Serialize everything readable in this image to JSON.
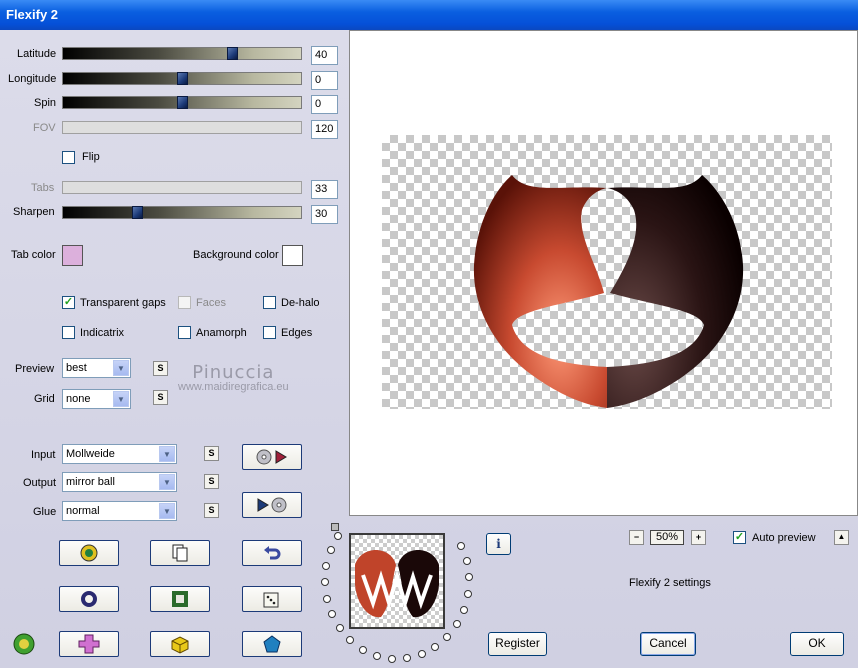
{
  "window": {
    "title": "Flexify 2"
  },
  "sliders": [
    {
      "label": "Latitude",
      "value": "40",
      "position": 0.71,
      "disabled": false
    },
    {
      "label": "Longitude",
      "value": "0",
      "position": 0.5,
      "disabled": false
    },
    {
      "label": "Spin",
      "value": "0",
      "position": 0.5,
      "disabled": false
    },
    {
      "label": "FOV",
      "value": "120",
      "disabled": true
    },
    {
      "label": "Tabs",
      "value": "33",
      "disabled": true
    },
    {
      "label": "Sharpen",
      "value": "30",
      "position": 0.31,
      "disabled": false
    }
  ],
  "flip": {
    "label": "Flip",
    "checked": false
  },
  "colors": {
    "tab_label": "Tab color",
    "tab_color": "#dcb0dc",
    "background_label": "Background color",
    "background_color": "#ffffff"
  },
  "options": {
    "transparent_gaps": {
      "label": "Transparent gaps",
      "checked": true
    },
    "faces": {
      "label": "Faces",
      "checked": false,
      "disabled": true
    },
    "de_halo": {
      "label": "De-halo",
      "checked": false
    },
    "indicatrix": {
      "label": "Indicatrix",
      "checked": false
    },
    "anamorph": {
      "label": "Anamorph",
      "checked": false
    },
    "edges": {
      "label": "Edges",
      "checked": false
    }
  },
  "selects": {
    "preview": {
      "label": "Preview",
      "value": "best"
    },
    "grid": {
      "label": "Grid",
      "value": "none"
    },
    "input": {
      "label": "Input",
      "value": "Mollweide"
    },
    "output": {
      "label": "Output",
      "value": "mirror ball"
    },
    "glue": {
      "label": "Glue",
      "value": "normal"
    }
  },
  "sync_glyph": "S",
  "watermark": {
    "line1": "Pinuccia",
    "line2": "www.maidiregrafica.eu"
  },
  "zoom": {
    "value": "50%",
    "minus": "−",
    "plus": "+"
  },
  "auto_preview": {
    "label": "Auto preview",
    "checked": true
  },
  "settings_label": "Flexify 2 settings",
  "buttons": {
    "register": "Register",
    "cancel": "Cancel",
    "ok": "OK"
  },
  "info_glyph": "i",
  "up_glyph": "▲",
  "accent": "#0a5fe0"
}
